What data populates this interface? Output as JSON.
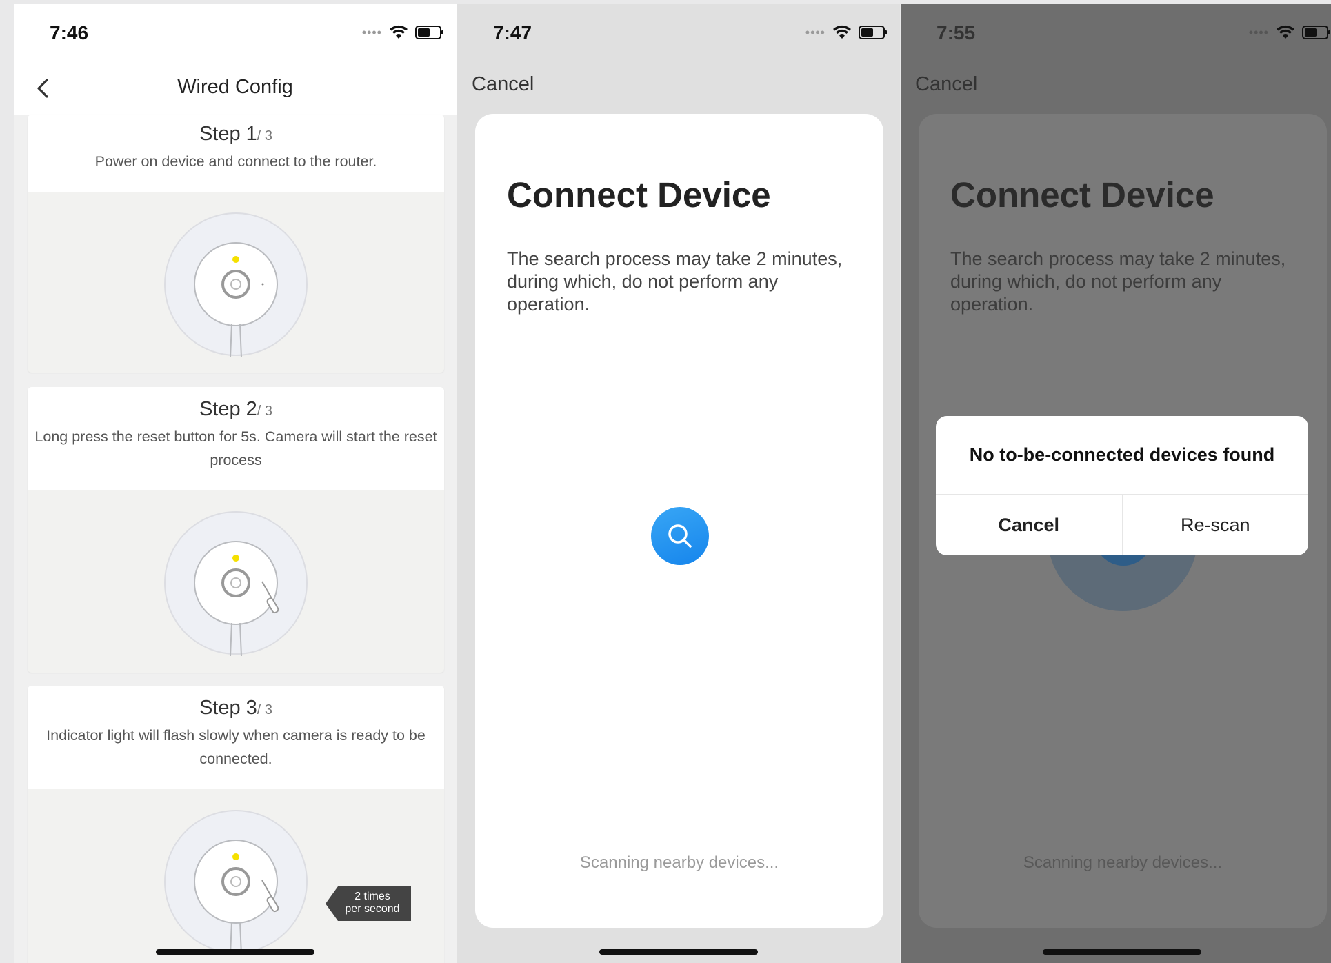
{
  "screens": [
    {
      "time": "7:46",
      "nav_title": "Wired Config",
      "steps": [
        {
          "number": "Step 1",
          "total": "/ 3",
          "text": "Power on device and connect to the router."
        },
        {
          "number": "Step 2",
          "total": "/ 3",
          "text": "Long press the reset button for 5s. Camera will start the reset process"
        },
        {
          "number": "Step 3",
          "total": "/ 3",
          "text": "Indicator light will flash slowly when camera is ready to be connected."
        }
      ],
      "blink_label_line1": "2 times",
      "blink_label_line2": "per second",
      "indicator_color": "#f5e000"
    },
    {
      "time": "7:47",
      "cancel": "Cancel",
      "title": "Connect Device",
      "description": "The search process may take 2 minutes, during which, do not perform any operation.",
      "scanning": "Scanning nearby devices...",
      "accent": "#1f8ff0"
    },
    {
      "time": "7:55",
      "cancel": "Cancel",
      "title": "Connect Device",
      "description": "The search process may take 2 minutes, during which, do not perform any operation.",
      "scanning": "Scanning nearby devices...",
      "dialog": {
        "message": "No to-be-connected devices found",
        "cancel": "Cancel",
        "rescan": "Re-scan"
      }
    }
  ],
  "icons": [
    "chevron-left-icon",
    "wifi-icon",
    "battery-icon",
    "search-icon"
  ]
}
